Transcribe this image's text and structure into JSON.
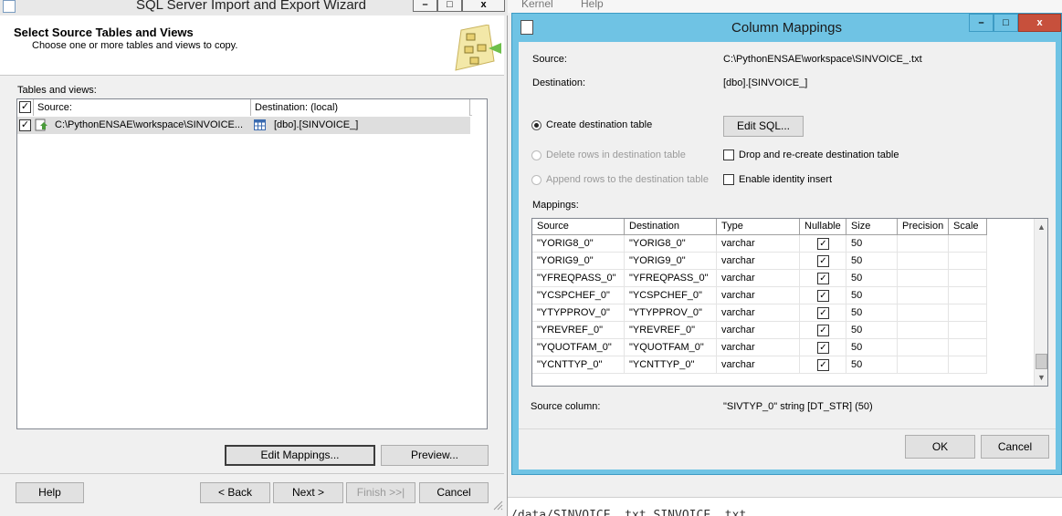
{
  "background": {
    "menu_items": [
      "Kernel",
      "Help"
    ],
    "code_text": "/data/SINVOICE_.txt SINVOICE_.txt"
  },
  "wizard": {
    "title": "SQL Server Import and Export Wizard",
    "header_title": "Select Source Tables and Views",
    "header_subtitle": "Choose one or more tables and views to copy.",
    "tables_label": "Tables and views:",
    "columns": {
      "source": "Source:",
      "destination": "Destination: (local)"
    },
    "rows": [
      {
        "source": "C:\\PythonENSAE\\workspace\\SINVOICE...",
        "destination": "[dbo].[SINVOICE_]",
        "checked": true
      }
    ],
    "buttons": {
      "edit_mappings": "Edit Mappings...",
      "preview": "Preview...",
      "help": "Help",
      "back": "< Back",
      "next": "Next >",
      "finish": "Finish >>|",
      "cancel": "Cancel"
    },
    "window_buttons": {
      "minimize": "–",
      "maximize": "□",
      "close": "x"
    }
  },
  "dialog": {
    "title": "Column Mappings",
    "source_label": "Source:",
    "source_value": "C:\\PythonENSAE\\workspace\\SINVOICE_.txt",
    "destination_label": "Destination:",
    "destination_value": "[dbo].[SINVOICE_]",
    "options": {
      "create": "Create destination table",
      "delete": "Delete rows in destination table",
      "append": "Append rows to the destination table",
      "selected": "create"
    },
    "edit_sql": "Edit SQL...",
    "drop_recreate": "Drop and re-create destination table",
    "identity_insert": "Enable identity insert",
    "mappings_label": "Mappings:",
    "mapping_columns": [
      "Source",
      "Destination",
      "Type",
      "Nullable",
      "Size",
      "Precision",
      "Scale"
    ],
    "mappings": [
      {
        "source": "\"YORIG8_0\"",
        "destination": "\"YORIG8_0\"",
        "type": "varchar",
        "nullable": true,
        "size": "50"
      },
      {
        "source": "\"YORIG9_0\"",
        "destination": "\"YORIG9_0\"",
        "type": "varchar",
        "nullable": true,
        "size": "50"
      },
      {
        "source": "\"YFREQPASS_0\"",
        "destination": "\"YFREQPASS_0\"",
        "type": "varchar",
        "nullable": true,
        "size": "50"
      },
      {
        "source": "\"YCSPCHEF_0\"",
        "destination": "\"YCSPCHEF_0\"",
        "type": "varchar",
        "nullable": true,
        "size": "50"
      },
      {
        "source": "\"YTYPPROV_0\"",
        "destination": "\"YTYPPROV_0\"",
        "type": "varchar",
        "nullable": true,
        "size": "50"
      },
      {
        "source": "\"YREVREF_0\"",
        "destination": "\"YREVREF_0\"",
        "type": "varchar",
        "nullable": true,
        "size": "50"
      },
      {
        "source": "\"YQUOTFAM_0\"",
        "destination": "\"YQUOTFAM_0\"",
        "type": "varchar",
        "nullable": true,
        "size": "50"
      },
      {
        "source": "\"YCNTTYP_0\"",
        "destination": "\"YCNTTYP_0\"",
        "type": "varchar",
        "nullable": true,
        "size": "50"
      }
    ],
    "source_column_label": "Source column:",
    "source_column_value": "\"SIVTYP_0\" string [DT_STR] (50)",
    "ok": "OK",
    "cancel": "Cancel",
    "window_buttons": {
      "minimize": "–",
      "maximize": "□",
      "close": "x"
    }
  }
}
